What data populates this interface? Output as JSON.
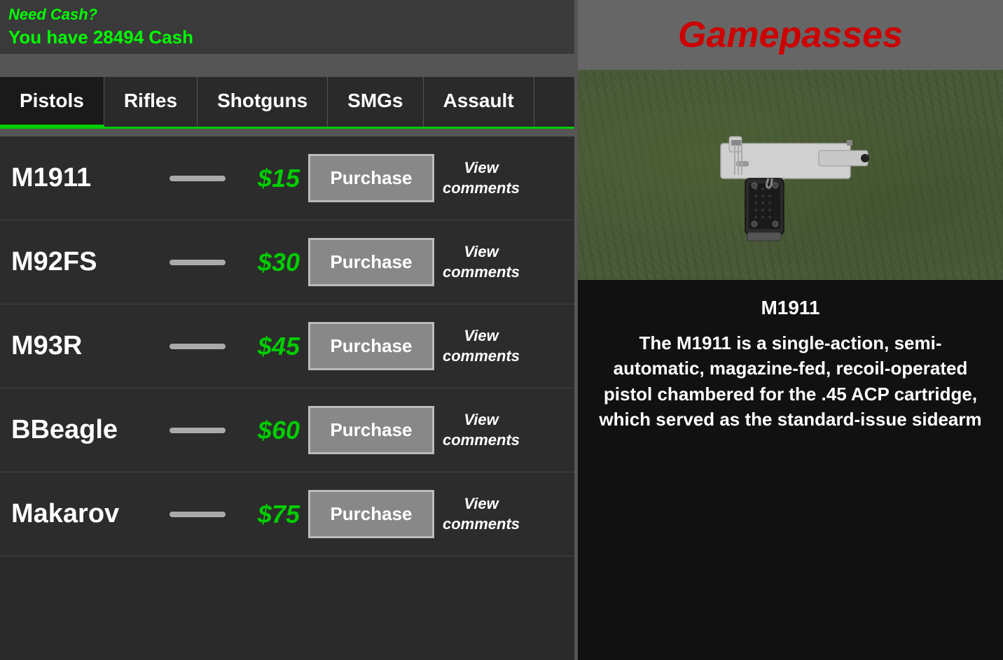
{
  "topBar": {
    "needCash": "Need Cash?",
    "cashDisplay": "You have 28494 Cash"
  },
  "tabs": [
    {
      "id": "pistols",
      "label": "Pistols",
      "active": true
    },
    {
      "id": "rifles",
      "label": "Rifles",
      "active": false
    },
    {
      "id": "shotguns",
      "label": "Shotguns",
      "active": false
    },
    {
      "id": "smgs",
      "label": "SMGs",
      "active": false
    },
    {
      "id": "assault",
      "label": "Assault",
      "active": false
    }
  ],
  "weapons": [
    {
      "id": "m1911",
      "name": "M1911",
      "price": "$15",
      "purchaseLabel": "Purchase",
      "viewLabel": "View\ncomments"
    },
    {
      "id": "m92fs",
      "name": "M92FS",
      "price": "$30",
      "purchaseLabel": "Purchase",
      "viewLabel": "View\ncomments"
    },
    {
      "id": "m93r",
      "name": "M93R",
      "price": "$45",
      "purchaseLabel": "Purchase",
      "viewLabel": "View\ncomments"
    },
    {
      "id": "bbeagle",
      "name": "BBeagle",
      "price": "$60",
      "purchaseLabel": "Purchase",
      "viewLabel": "View\ncomments"
    },
    {
      "id": "makarov",
      "name": "Makarov",
      "price": "$75",
      "purchaseLabel": "Purchase",
      "viewLabel": "View\ncomments"
    }
  ],
  "rightPanel": {
    "title": "Gamepasses",
    "selectedWeapon": {
      "name": "M1911",
      "description": "The M1911 is a single-action, semi-automatic, magazine-fed, recoil-operated pistol chambered for the .45 ACP cartridge, which served as the standard-issue sidearm"
    }
  }
}
